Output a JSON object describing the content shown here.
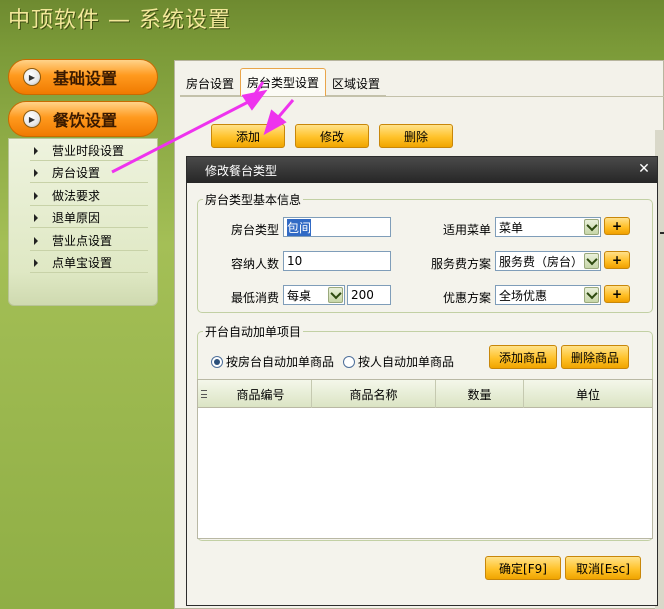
{
  "app": {
    "title": "中顶软件 — 系统设置"
  },
  "sidebar": {
    "groups": [
      {
        "label": "基础设置"
      },
      {
        "label": "餐饮设置"
      }
    ],
    "items": [
      {
        "label": "营业时段设置"
      },
      {
        "label": "房台设置"
      },
      {
        "label": "做法要求"
      },
      {
        "label": "退单原因"
      },
      {
        "label": "营业点设置"
      },
      {
        "label": "点单宝设置"
      }
    ]
  },
  "tabs": [
    {
      "label": "房台设置"
    },
    {
      "label": "房台类型设置",
      "active": true
    },
    {
      "label": "区域设置"
    }
  ],
  "toolbar": {
    "add_label": "添加",
    "edit_label": "修改",
    "delete_label": "删除"
  },
  "dialog": {
    "title": "修改餐台类型",
    "close_glyph": "✕",
    "basic_group": {
      "title": "房台类型基本信息",
      "room_type_label": "房台类型",
      "room_type_value": "包间",
      "capacity_label": "容纳人数",
      "capacity_value": "10",
      "min_spend_label": "最低消费",
      "min_spend_mode": "每桌",
      "min_spend_value": "200",
      "menu_label": "适用菜单",
      "menu_value": "菜单",
      "service_label": "服务费方案",
      "service_value": "服务费（房台）",
      "discount_label": "优惠方案",
      "discount_value": "全场优惠",
      "plus_glyph": "+"
    },
    "auto_group": {
      "title": "开台自动加单项目",
      "radio_room": "按房台自动加单商品",
      "radio_person": "按人自动加单商品",
      "selected": "room",
      "add_goods_label": "添加商品",
      "delete_goods_label": "删除商品",
      "columns": [
        "商品编号",
        "商品名称",
        "数量",
        "单位"
      ]
    },
    "ok_label": "确定[F9]",
    "cancel_label": "取消[Esc]"
  },
  "colors": {
    "accent_orange": "#ffc22a",
    "annotation_arrow": "#ee33ee",
    "title_bar": "#262626"
  }
}
